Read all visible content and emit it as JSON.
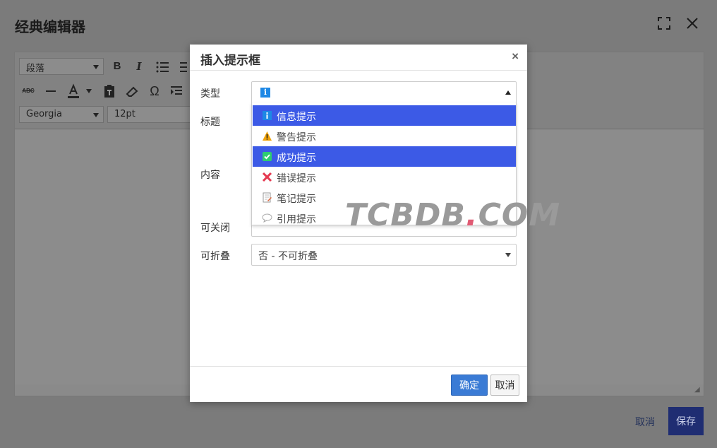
{
  "window": {
    "title": "经典编辑器",
    "fullscreen_icon": "fullscreen-icon",
    "close_icon": "close-icon"
  },
  "toolbar": {
    "block_format": "段落",
    "font_family": "Georgia",
    "font_size": "12pt",
    "bold": "B",
    "italic": "I",
    "strike": "ABC",
    "omega": "Ω"
  },
  "footer": {
    "cancel_label": "取消",
    "save_label": "保存"
  },
  "dialog": {
    "title": "插入提示框",
    "close": "×",
    "labels": {
      "type": "类型",
      "title": "标题",
      "content": "内容",
      "closable": "可关闭",
      "collapsible": "可折叠"
    },
    "type_field": {
      "icon": "info-icon",
      "icon_text": "i"
    },
    "type_options": [
      {
        "label": "信息提示",
        "icon": "info-icon",
        "selected": true
      },
      {
        "label": "警告提示",
        "icon": "warning-icon",
        "selected": false
      },
      {
        "label": "成功提示",
        "icon": "success-icon",
        "selected": true
      },
      {
        "label": "错误提示",
        "icon": "error-icon",
        "selected": false
      },
      {
        "label": "笔记提示",
        "icon": "note-icon",
        "selected": false
      },
      {
        "label": "引用提示",
        "icon": "quote-icon",
        "selected": false
      }
    ],
    "collapsible_value": "否 - 不可折叠",
    "ok_label": "确定",
    "cancel_label": "取消"
  },
  "watermark": {
    "text_a": "TCBDB",
    "dot": ".",
    "text_b": "COM"
  },
  "colors": {
    "selection": "#3c5ae6",
    "primary_button": "#3a7bd5",
    "save_button": "#1f2d72"
  }
}
